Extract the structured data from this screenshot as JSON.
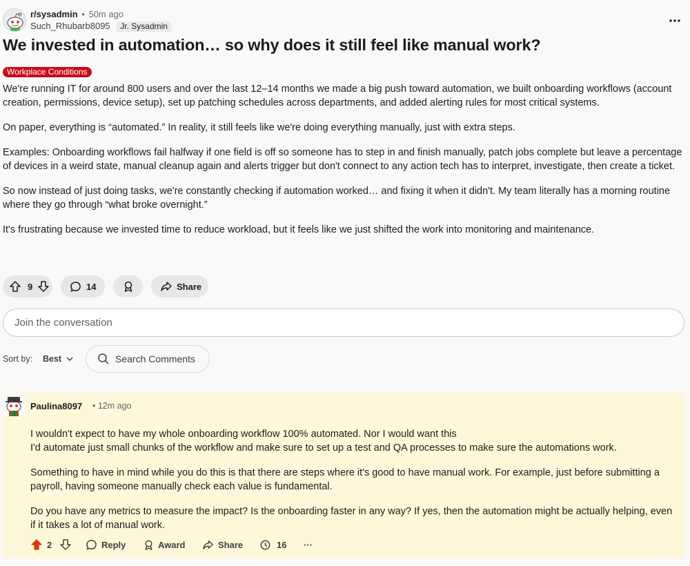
{
  "post": {
    "subreddit": "r/sysadmin",
    "time_ago": "50m ago",
    "author": "Such_Rhubarb8095",
    "user_flair": "Jr. Sysadmin",
    "title": "We invested in automation… so why does it still feel like manual work?",
    "post_flair": "Workplace Conditions",
    "paragraphs": [
      "We're running IT for around 800 users and over the last 12–14 months we made a big push toward automation, we built onboarding workflows (account creation, permissions, device setup), set up patching schedules across departments, and added alerting rules for most critical systems.",
      "On paper, everything is “automated.” In reality, it still feels like we're doing everything manually, just with extra steps.",
      "Examples: Onboarding workflows fail halfway if one field is off so someone has to step in and finish manually, patch jobs complete but leave a percentage of devices in a weird state, manual cleanup again and alerts trigger but don't connect to any action tech has to interpret, investigate, then create a ticket.",
      "So now instead of just doing tasks, we're constantly checking if automation worked… and fixing it when it didn't. My team literally has a morning routine where they go through “what broke overnight.”",
      "It's frustrating because we invested time to reduce workload, but it feels like we just shifted the work into monitoring and maintenance."
    ],
    "votes": "9",
    "comments": "14",
    "share_label": "Share"
  },
  "composer": {
    "placeholder": "Join the conversation"
  },
  "sort": {
    "label": "Sort by:",
    "value": "Best",
    "search_label": "Search Comments"
  },
  "comment": {
    "author": "Paulina8097",
    "time_ago": "12m ago",
    "paragraphs": [
      "I wouldn't expect to have my whole onboarding workflow 100% automated. Nor I would want this",
      "I'd automate just small chunks of the workflow and make sure to set up a test and QA processes to make sure the automations work.",
      "Something to have in mind while you do this is that there are steps where it's good to have manual work. For example, just before submitting a payroll, having someone manually check each value is fundamental.",
      "Do you have any metrics to measure the impact? Is the onboarding faster in any way? If yes, then the automation might be actually helping, even if it takes a lot of manual work."
    ],
    "votes": "2",
    "reply_label": "Reply",
    "award_label": "Award",
    "share_label": "Share",
    "count": "16",
    "more": "···"
  },
  "colors": {
    "upvoted": "#d93a00",
    "flair_bg": "#c80c18",
    "comment_highlight": "#fdf8d9"
  }
}
